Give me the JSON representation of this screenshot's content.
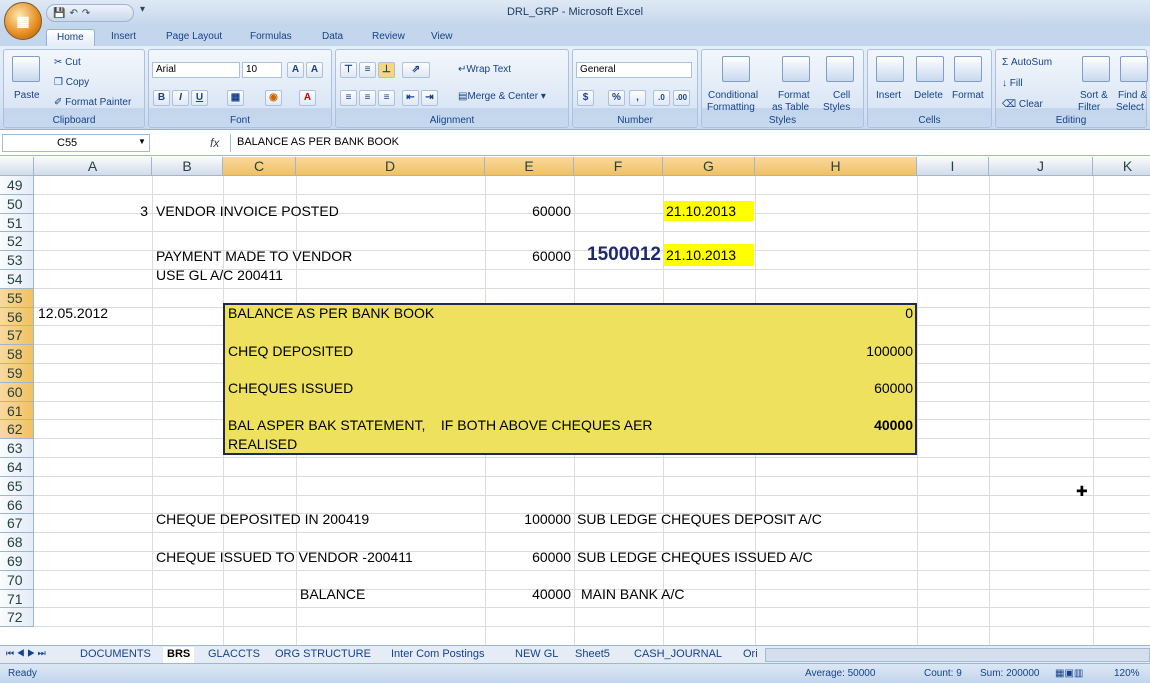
{
  "app": {
    "title": "DRL_GRP - Microsoft Excel",
    "office_button_letter": "⌂"
  },
  "tabs": [
    "Home",
    "Insert",
    "Page Layout",
    "Formulas",
    "Data",
    "Review",
    "View"
  ],
  "ribbon": {
    "clipboard": {
      "label": "Clipboard",
      "paste": "Paste",
      "cut": "Cut",
      "copy": "Copy",
      "format_painter": "Format Painter"
    },
    "font": {
      "label": "Font",
      "name": "Arial",
      "size": "10"
    },
    "alignment": {
      "label": "Alignment",
      "wrap_text": "Wrap Text",
      "merge_center": "Merge & Center"
    },
    "number": {
      "label": "Number",
      "format": "General",
      "currency": "$",
      "percent": "%",
      "comma": ","
    },
    "styles": {
      "label": "Styles",
      "conditional": "Conditional",
      "formatting": "Formatting",
      "format_as": "Format",
      "as_table": "as Table",
      "cell": "Cell",
      "cell_styles": "Styles"
    },
    "cells": {
      "label": "Cells",
      "insert": "Insert",
      "delete": "Delete",
      "format": "Format"
    },
    "editing": {
      "label": "Editing",
      "autosum": "AutoSum",
      "fill": "Fill",
      "clear": "Clear",
      "sort": "Sort &",
      "filter": "Filter",
      "find": "Find &",
      "select": "Select"
    }
  },
  "formula_bar": {
    "name_box": "C55",
    "fx": "fx",
    "content": "BALANCE AS PER BANK BOOK"
  },
  "columns": [
    "A",
    "B",
    "C",
    "D",
    "E",
    "F",
    "G",
    "H",
    "I",
    "J",
    "K"
  ],
  "rows": [
    "49",
    "50",
    "51",
    "52",
    "53",
    "54",
    "55",
    "56",
    "57",
    "58",
    "59",
    "60",
    "61",
    "62",
    "63",
    "64",
    "65",
    "66",
    "67",
    "68",
    "69",
    "70",
    "71",
    "72"
  ],
  "cells": {
    "b50": "3",
    "c50": "VENDOR INVOICE POSTED",
    "e50": "60000",
    "g50": "21.10.2013",
    "c52": "PAYMENT MADE TO VENDOR",
    "e52": "60000",
    "f52": "1500012",
    "g52": "21.10.2013",
    "c53": "USE GL A/C 200411",
    "a55": "12.05.2012",
    "c55": "BALANCE AS PER BANK BOOK",
    "h55": "0",
    "c57": "CHEQ DEPOSITED",
    "h57": "100000",
    "c59": "CHEQUES ISSUED",
    "h59": "60000",
    "c61": "BAL ASPER BAK STATEMENT,    IF BOTH ABOVE CHEQUES AER",
    "h61": "40000",
    "c62": "REALISED",
    "c66": "CHEQUE DEPOSITED IN 200419",
    "e66": "100000",
    "f66": "SUB LEDGE CHEQUES DEPOSIT A/C",
    "c68": "CHEQUE ISSUED TO VENDOR -200411",
    "e68": "60000",
    "f68": "SUB LEDGE CHEQUES ISSUED A/C",
    "d70": "BALANCE",
    "e70": "40000",
    "f70": "MAIN BANK A/C"
  },
  "sheets": [
    "DOCUMENTS",
    "BRS",
    "GLACCTS",
    "ORG STRUCTURE",
    "Inter Com Postings",
    "NEW GL",
    "Sheet5",
    "CASH_JOURNAL",
    "Ori"
  ],
  "active_sheet": "BRS",
  "status": {
    "ready": "Ready",
    "average": "Average: 50000",
    "count": "Count: 9",
    "sum": "Sum: 200000",
    "zoom": "120%"
  },
  "colors": {
    "highlight": "#ffff00",
    "selection_fill": "#ede15d",
    "accent": "#15428b"
  }
}
